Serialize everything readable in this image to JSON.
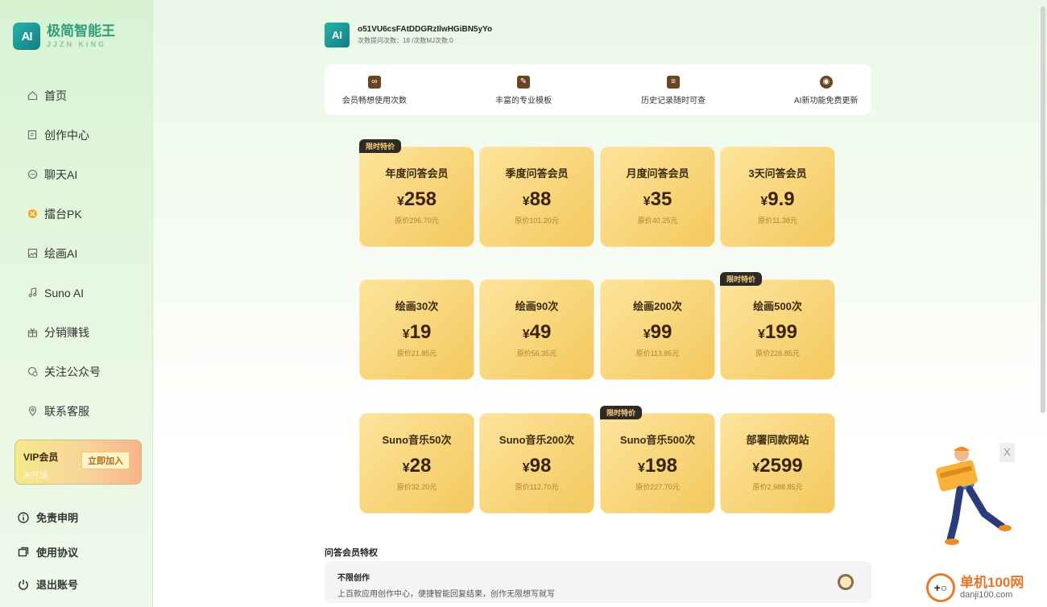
{
  "brand": {
    "logo_text": "AI",
    "title": "极简智能王",
    "subtitle": "JJZN KING"
  },
  "sidebar": {
    "items": [
      {
        "label": "首页",
        "icon": "home-icon"
      },
      {
        "label": "创作中心",
        "icon": "edit-icon"
      },
      {
        "label": "聊天AI",
        "icon": "chat-icon"
      },
      {
        "label": "擂台PK",
        "icon": "pk-icon"
      },
      {
        "label": "绘画AI",
        "icon": "image-icon"
      },
      {
        "label": "Suno AI",
        "icon": "music-icon"
      },
      {
        "label": "分销赚钱",
        "icon": "gift-icon"
      },
      {
        "label": "关注公众号",
        "icon": "wechat-icon"
      },
      {
        "label": "联系客服",
        "icon": "location-icon"
      }
    ],
    "vip": {
      "title": "VIP会员",
      "status": "未开通",
      "join_label": "立即加入"
    },
    "bottom": [
      {
        "label": "免责申明",
        "icon": "info-icon"
      },
      {
        "label": "使用协议",
        "icon": "document-icon"
      },
      {
        "label": "退出账号",
        "icon": "power-icon"
      }
    ]
  },
  "user": {
    "avatar_text": "AI",
    "name": "o51VU6csFAtDDGRzIlwHGiBN5yYo",
    "counts": "次数提问次数：18 /次数MJ次数:0"
  },
  "benefits": [
    {
      "label": "会员畅想使用次数",
      "icon": "infinity-icon"
    },
    {
      "label": "丰富的专业模板",
      "icon": "template-icon"
    },
    {
      "label": "历史记录随时可查",
      "icon": "history-icon"
    },
    {
      "label": "AI新功能免费更新",
      "icon": "update-icon"
    }
  ],
  "plans": [
    {
      "name": "年度问答会员",
      "yen": "¥",
      "price": "258",
      "original": "原价296.70元",
      "tag": "限时特价"
    },
    {
      "name": "季度问答会员",
      "yen": "¥",
      "price": "88",
      "original": "原价101.20元",
      "tag": ""
    },
    {
      "name": "月度问答会员",
      "yen": "¥",
      "price": "35",
      "original": "原价40.25元",
      "tag": ""
    },
    {
      "name": "3天问答会员",
      "yen": "¥",
      "price": "9.9",
      "original": "原价11.38元",
      "tag": ""
    },
    {
      "name": "绘画30次",
      "yen": "¥",
      "price": "19",
      "original": "原价21.85元",
      "tag": ""
    },
    {
      "name": "绘画90次",
      "yen": "¥",
      "price": "49",
      "original": "原价56.35元",
      "tag": ""
    },
    {
      "name": "绘画200次",
      "yen": "¥",
      "price": "99",
      "original": "原价113.85元",
      "tag": ""
    },
    {
      "name": "绘画500次",
      "yen": "¥",
      "price": "199",
      "original": "原价228.85元",
      "tag": "限时特价"
    },
    {
      "name": "Suno音乐50次",
      "yen": "¥",
      "price": "28",
      "original": "原价32.20元",
      "tag": ""
    },
    {
      "name": "Suno音乐200次",
      "yen": "¥",
      "price": "98",
      "original": "原价112.70元",
      "tag": ""
    },
    {
      "name": "Suno音乐500次",
      "yen": "¥",
      "price": "198",
      "original": "原价227.70元",
      "tag": "限时特价"
    },
    {
      "name": "部署同款网站",
      "yen": "¥",
      "price": "2599",
      "original": "原价2,988.85元",
      "tag": ""
    }
  ],
  "privileges": {
    "section_title": "问答会员特权",
    "items": [
      {
        "name": "不限创作",
        "desc": "上百款应用创作中心，便捷智能回复结果，创作无限想写就写"
      }
    ]
  },
  "popup": {
    "close_label": "X"
  },
  "watermark": {
    "logo_text": "+○",
    "cn": "单机100网",
    "en": "danji100.com"
  }
}
